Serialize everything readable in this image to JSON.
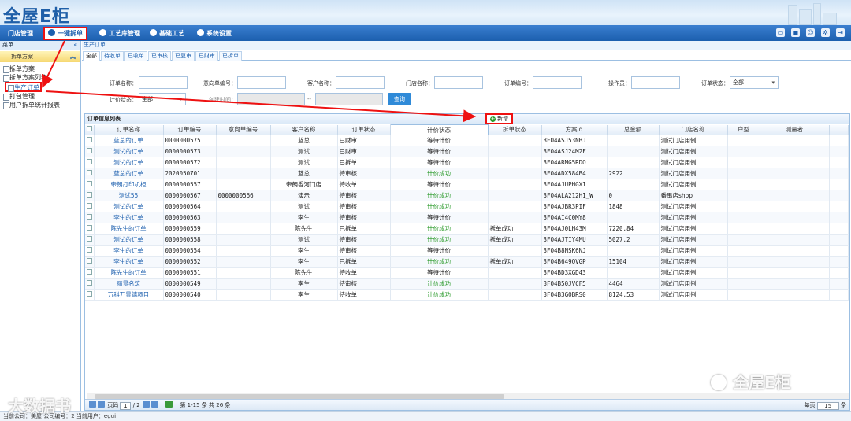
{
  "app": {
    "logo": "全屋E柜"
  },
  "nav": {
    "items": [
      "门店管理",
      "一键拆单",
      "工艺库管理",
      "基础工艺",
      "系统设置"
    ],
    "icons": [
      "monitor-icon",
      "save-icon",
      "user-icon",
      "gear-icon",
      "exit-icon"
    ]
  },
  "sidebar": {
    "title": "菜单",
    "group": "拆单方案",
    "items": [
      "拆单方案",
      "拆单方案列表",
      "生产订单",
      "打包管理",
      "用户拆单统计报表"
    ]
  },
  "breadcrumb": "生产订单",
  "status_tabs": [
    "全部",
    "待收单",
    "已收单",
    "已审核",
    "已复审",
    "已财审",
    "已拆单"
  ],
  "filters": {
    "order_name_label": "订单名称：",
    "intent_no_label": "意向单编号：",
    "customer_label": "客户名称：",
    "store_label": "门店名称：",
    "order_no_label": "订单编号：",
    "operator_label": "操作员：",
    "order_status_label": "订单状态：",
    "order_status_value": "全部",
    "price_status_label": "计价状态：",
    "price_status_value": "全部",
    "created_label": "创建时间：",
    "range_sep": "--",
    "query_button": "查询"
  },
  "grid": {
    "title": "订单信息列表",
    "new_button": "新增",
    "columns": [
      "订单名称",
      "订单编号",
      "意向单编号",
      "客户名称",
      "订单状态",
      "计价状态",
      "拆单状态",
      "方案id",
      "总金额",
      "门店名称",
      "户型",
      "测量者"
    ],
    "rows": [
      [
        "蓝总的订单",
        "0000000575",
        "",
        "蓝总",
        "已财审",
        "等待计价",
        "",
        "3FO4ASJ53NBJ",
        "",
        "测试门店用例",
        "",
        ""
      ],
      [
        "测试的订单",
        "0000000573",
        "",
        "测试",
        "已财审",
        "等待计价",
        "",
        "3FO4ASJ24M2F",
        "",
        "测试门店用例",
        "",
        ""
      ],
      [
        "测试的订单",
        "0000000572",
        "",
        "测试",
        "已拆单",
        "等待计价",
        "",
        "3FO4ARMG5RDO",
        "",
        "测试门店用例",
        "",
        ""
      ],
      [
        "蓝总的订单",
        "2020050701",
        "",
        "蓝总",
        "待审核",
        "计价成功",
        "",
        "3FO4ADX584B4",
        "2922",
        "测试门店用例",
        "",
        ""
      ],
      [
        "帝朗打印机柜",
        "0000000557",
        "",
        "帝朗香河门店",
        "待收单",
        "等待计价",
        "",
        "3FO4AJUPHGXI",
        "",
        "测试门店用例",
        "",
        ""
      ],
      [
        "测试55",
        "0000000567",
        "0000000566",
        "演示",
        "待审核",
        "计价成功",
        "",
        "3FO4ALA212H1_W",
        "0",
        "番禺店shop",
        "",
        ""
      ],
      [
        "测试的订单",
        "0000000564",
        "",
        "测试",
        "待审核",
        "计价成功",
        "",
        "3FO4AJBR3PIF",
        "1848",
        "测试门店用例",
        "",
        ""
      ],
      [
        "李生的订单",
        "0000000563",
        "",
        "李生",
        "待审核",
        "等待计价",
        "",
        "3FO4AI4C0MY8",
        "",
        "测试门店用例",
        "",
        ""
      ],
      [
        "陈先生的订单",
        "0000000559",
        "",
        "陈先生",
        "已拆单",
        "计价成功",
        "拆单成功",
        "3FO4AJ0LH43M",
        "7220.84",
        "测试门店用例",
        "",
        ""
      ],
      [
        "测试的订单",
        "0000000558",
        "",
        "测试",
        "待审核",
        "计价成功",
        "拆单成功",
        "3FO4AJTIY4MU",
        "5027.2",
        "测试门店用例",
        "",
        ""
      ],
      [
        "李生的订单",
        "0000000554",
        "",
        "李生",
        "待审核",
        "等待计价",
        "",
        "3FO4B8NSK6NJ",
        "",
        "测试门店用例",
        "",
        ""
      ],
      [
        "李生的订单",
        "0000000552",
        "",
        "李生",
        "已拆单",
        "计价成功",
        "拆单成功",
        "3FO4B649OVGP",
        "15104",
        "测试门店用例",
        "",
        ""
      ],
      [
        "陈先生的订单",
        "0000000551",
        "",
        "陈先生",
        "待收单",
        "等待计价",
        "",
        "3FO4BD3XGD43",
        "",
        "测试门店用例",
        "",
        ""
      ],
      [
        "丽景名筑",
        "0000000549",
        "",
        "李生",
        "待审核",
        "计价成功",
        "",
        "3FO4B50JVCF5",
        "4464",
        "测试门店用例",
        "",
        ""
      ],
      [
        "万科万景德项目",
        "0000000540",
        "",
        "李生",
        "待收单",
        "计价成功",
        "",
        "3FO4B3GOBRS0",
        "8124.53",
        "测试门店用例",
        "",
        ""
      ]
    ]
  },
  "pager": {
    "page_label": "页码",
    "page_value": "1",
    "total_pages": "/ 2",
    "range_text": "第 1-15 条  共 26 条",
    "per_page_label": "每页",
    "per_page_value": "15",
    "per_page_suffix": "条"
  },
  "statusbar": "当前公司：美屋   公司编号：2   当前用户：egui",
  "watermarks": {
    "left": "大数据书",
    "right": "全屋E柜"
  },
  "colors": {
    "accent": "#1c5fae",
    "highlight": "#e11111",
    "success": "#2a9a2a"
  }
}
